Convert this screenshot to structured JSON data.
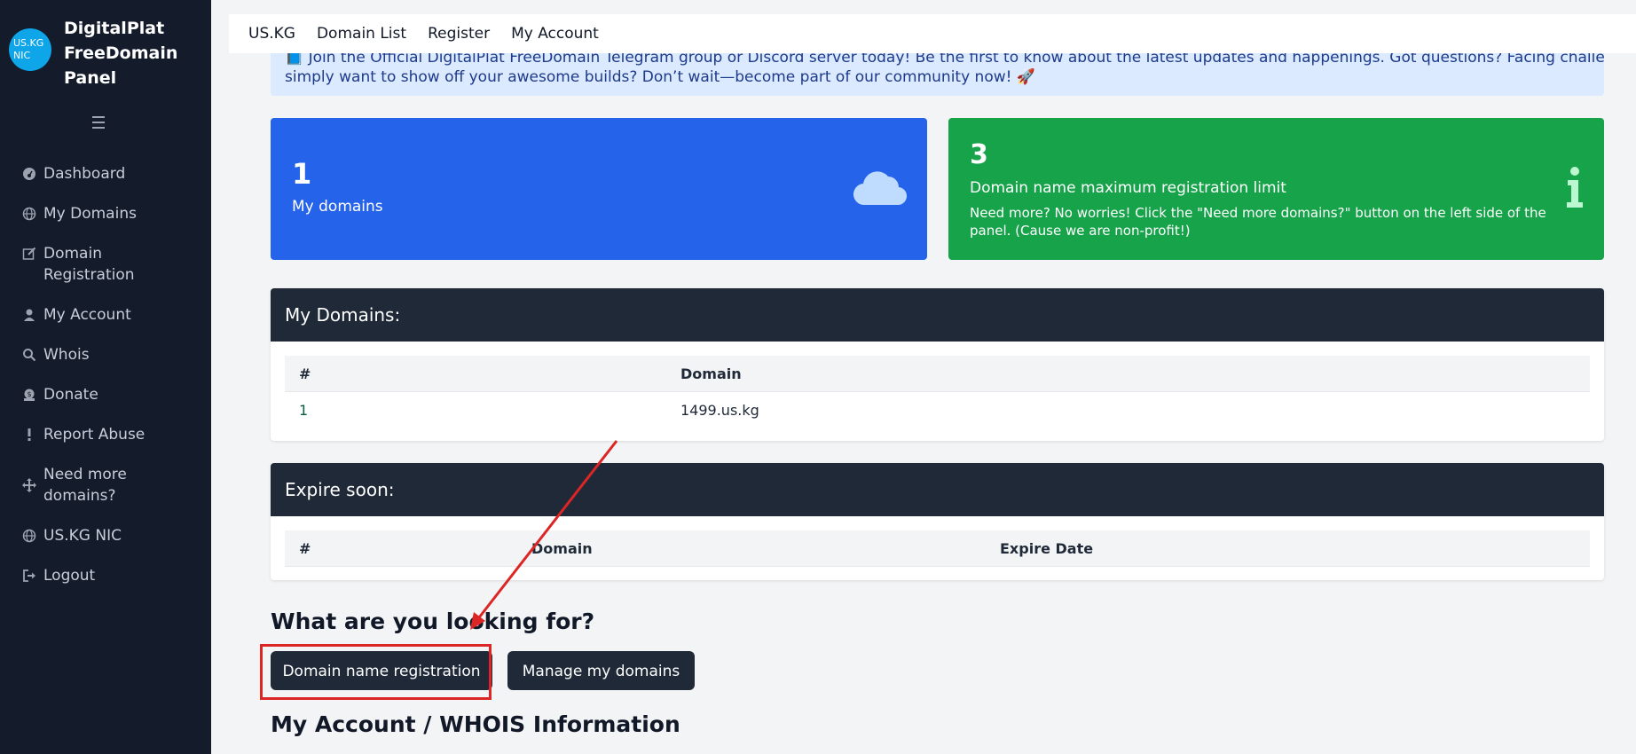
{
  "sidebar": {
    "logo_text": "US.KG NIC",
    "brand_name": "DigitalPlat FreeDomain Panel",
    "items": [
      {
        "label": "Dashboard",
        "icon": "gauge-icon"
      },
      {
        "label": "My Domains",
        "icon": "globe-icon"
      },
      {
        "label": "Domain Registration",
        "icon": "edit-icon"
      },
      {
        "label": "My Account",
        "icon": "user-icon"
      },
      {
        "label": "Whois",
        "icon": "search-icon"
      },
      {
        "label": "Donate",
        "icon": "donate-icon"
      },
      {
        "label": "Report Abuse",
        "icon": "exclamation-icon"
      },
      {
        "label": "Need more domains?",
        "icon": "move-icon"
      },
      {
        "label": "US.KG NIC",
        "icon": "globe-icon"
      },
      {
        "label": "Logout",
        "icon": "logout-icon"
      }
    ]
  },
  "topnav": {
    "items": [
      "US.KG",
      "Domain List",
      "Register",
      "My Account"
    ]
  },
  "announcement": {
    "line1": "📘 Join the Official DigitalPlat FreeDomain Telegram group or Discord server today! Be the first to know about the latest updates and happenings. Got questions? Facing challenges? Or",
    "line2": "simply want to show off your awesome builds? Don’t wait—become part of our community now!",
    "emoji": "🚀"
  },
  "stats": {
    "domains_count": "1",
    "domains_label": "My domains",
    "limit_count": "3",
    "limit_title": "Domain name maximum registration limit",
    "limit_desc": "Need more? No worries! Click the \"Need more domains?\" button on the left side of the panel. (Cause we are non-profit!)"
  },
  "my_domains": {
    "title": "My Domains:",
    "headers": [
      "#",
      "Domain"
    ],
    "rows": [
      {
        "num": "1",
        "domain": "1499.us.kg"
      }
    ]
  },
  "expire_soon": {
    "title": "Expire soon:",
    "headers": [
      "#",
      "Domain",
      "Expire Date"
    ]
  },
  "looking_for": {
    "title": "What are you looking for?",
    "btn_register": "Domain name registration",
    "btn_manage": "Manage my domains"
  },
  "account_section": {
    "title": "My Account / WHOIS Information"
  },
  "colors": {
    "sidebar_bg": "#141b2b",
    "blue_card": "#2563eb",
    "green_card": "#16a34a",
    "panel_head": "#1f2937",
    "highlight": "#dc2626"
  }
}
